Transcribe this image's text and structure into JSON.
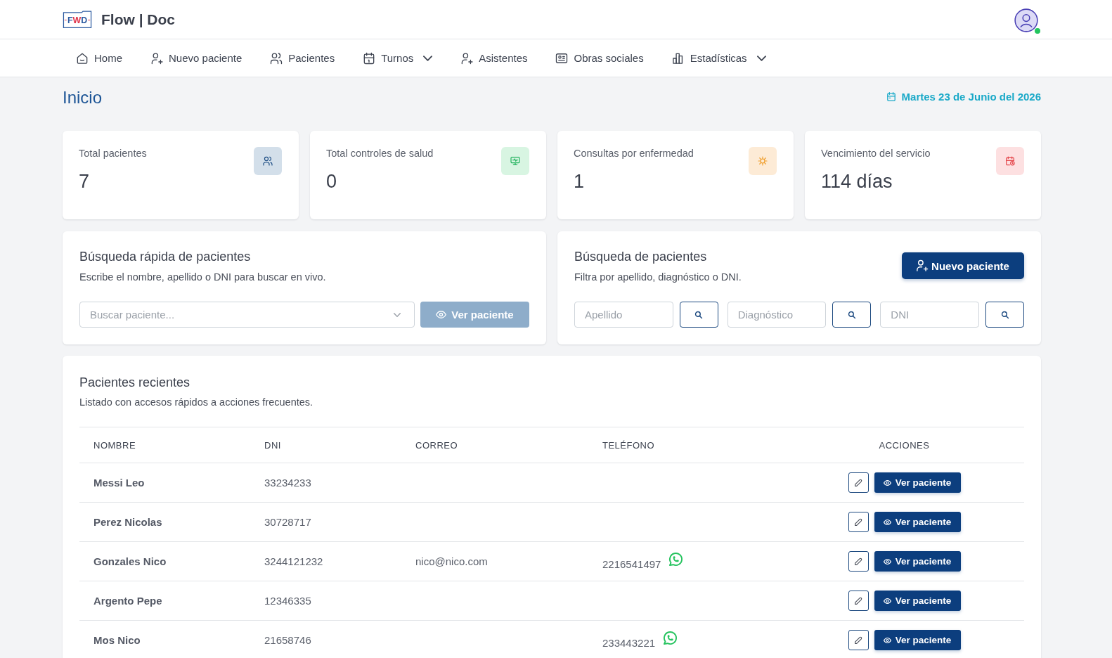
{
  "header": {
    "logo_text": "FWD",
    "brand": "Flow | Doc",
    "user": {
      "online": true
    }
  },
  "nav": [
    {
      "label": "Home",
      "kind": "home",
      "dropdown": false
    },
    {
      "label": "Nuevo paciente",
      "kind": "user-plus",
      "dropdown": false
    },
    {
      "label": "Pacientes",
      "kind": "users",
      "dropdown": false
    },
    {
      "label": "Turnos",
      "kind": "calendar",
      "dropdown": true
    },
    {
      "label": "Asistentes",
      "kind": "user-plus",
      "dropdown": false
    },
    {
      "label": "Obras sociales",
      "kind": "id-card",
      "dropdown": false
    },
    {
      "label": "Estadísticas",
      "kind": "bar-chart",
      "dropdown": true
    }
  ],
  "page": {
    "title": "Inicio",
    "date": "Martes 23 de Junio del 2026"
  },
  "stats": [
    {
      "label": "Total pacientes",
      "value": "7",
      "kind": "users",
      "color": "#d3dfea"
    },
    {
      "label": "Total controles de salud",
      "value": "0",
      "kind": "monitor",
      "color": "#d8f5e2"
    },
    {
      "label": "Consultas por enfermedad",
      "value": "1",
      "kind": "virus",
      "color": "#fdebd6"
    },
    {
      "label": "Vencimiento del servicio",
      "value": "114 días",
      "kind": "calendar",
      "color": "#fde0e1"
    }
  ],
  "quick_search": {
    "title": "Búsqueda rápida de pacientes",
    "subtitle": "Escribe el nombre, apellido o DNI para buscar en vivo.",
    "placeholder": "Buscar paciente...",
    "button": {
      "label": "Ver paciente",
      "disabled": true
    }
  },
  "patient_search": {
    "title": "Búsqueda de pacientes",
    "subtitle": "Filtra por apellido, diagnóstico o DNI.",
    "button": "Nuevo paciente",
    "fields": [
      {
        "placeholder": "Apellido"
      },
      {
        "placeholder": "Diagnóstico"
      },
      {
        "placeholder": "DNI"
      }
    ]
  },
  "recent": {
    "title": "Pacientes recientes",
    "subtitle": "Listado con accesos rápidos a acciones frecuentes.",
    "columns": [
      "NOMBRE",
      "DNI",
      "CORREO",
      "TELÉFONO",
      "ACCIONES"
    ],
    "rows": [
      {
        "name": "Messi Leo",
        "dni": "33234233",
        "whatsapp": false,
        "action": "Ver paciente"
      },
      {
        "name": "Perez Nicolas",
        "dni": "30728717",
        "whatsapp": false,
        "action": "Ver paciente"
      },
      {
        "name": "Gonzales Nico",
        "dni": "3244121232",
        "email": "nico@nico.com",
        "phone": "2216541497",
        "whatsapp": true,
        "action": "Ver paciente"
      },
      {
        "name": "Argento Pepe",
        "dni": "12346335",
        "whatsapp": false,
        "action": "Ver paciente"
      },
      {
        "name": "Mos Nico",
        "dni": "21658746",
        "phone": "233443221",
        "whatsapp": true,
        "action": "Ver paciente"
      }
    ]
  }
}
